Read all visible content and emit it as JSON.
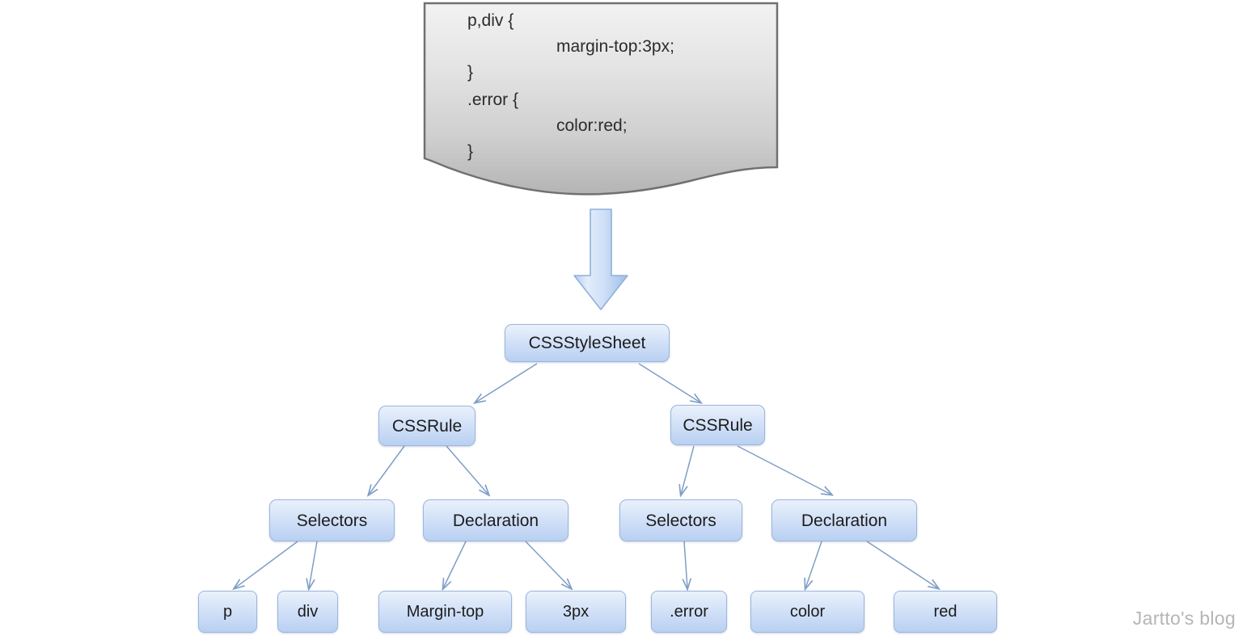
{
  "code_block": {
    "lines": [
      {
        "text": "p,div {",
        "indent": false
      },
      {
        "text": "margin-top:3px;",
        "indent": true
      },
      {
        "text": "}",
        "indent": false
      },
      {
        "text": ".error {",
        "indent": false
      },
      {
        "text": "color:red;",
        "indent": true
      },
      {
        "text": "}",
        "indent": false
      }
    ]
  },
  "arrow": {
    "label": "down-block-arrow"
  },
  "tree": {
    "root": {
      "label": "CSSStyleSheet"
    },
    "rules": [
      {
        "label": "CSSRule"
      },
      {
        "label": "CSSRule"
      }
    ],
    "parts": [
      {
        "label": "Selectors"
      },
      {
        "label": "Declaration"
      },
      {
        "label": "Selectors"
      },
      {
        "label": "Declaration"
      }
    ],
    "leaves": [
      {
        "label": "p"
      },
      {
        "label": "div"
      },
      {
        "label": "Margin-top"
      },
      {
        "label": "3px"
      },
      {
        "label": ".error"
      },
      {
        "label": "color"
      },
      {
        "label": "red"
      }
    ]
  },
  "watermark": {
    "text": "Jartto's blog"
  },
  "colors": {
    "node_border": "#9cb6dd",
    "node_fill_top": "#eaf1fb",
    "node_fill_bottom": "#b9d0f2",
    "connector": "#7f9fc6",
    "arrow_fill": "#c2d8f2",
    "arrow_border": "#8fb0d8",
    "doc_fill_top": "#efefef",
    "doc_fill_bottom": "#bdbdbd",
    "doc_border": "#6b6b6b",
    "watermark": "#b5b5b5"
  }
}
